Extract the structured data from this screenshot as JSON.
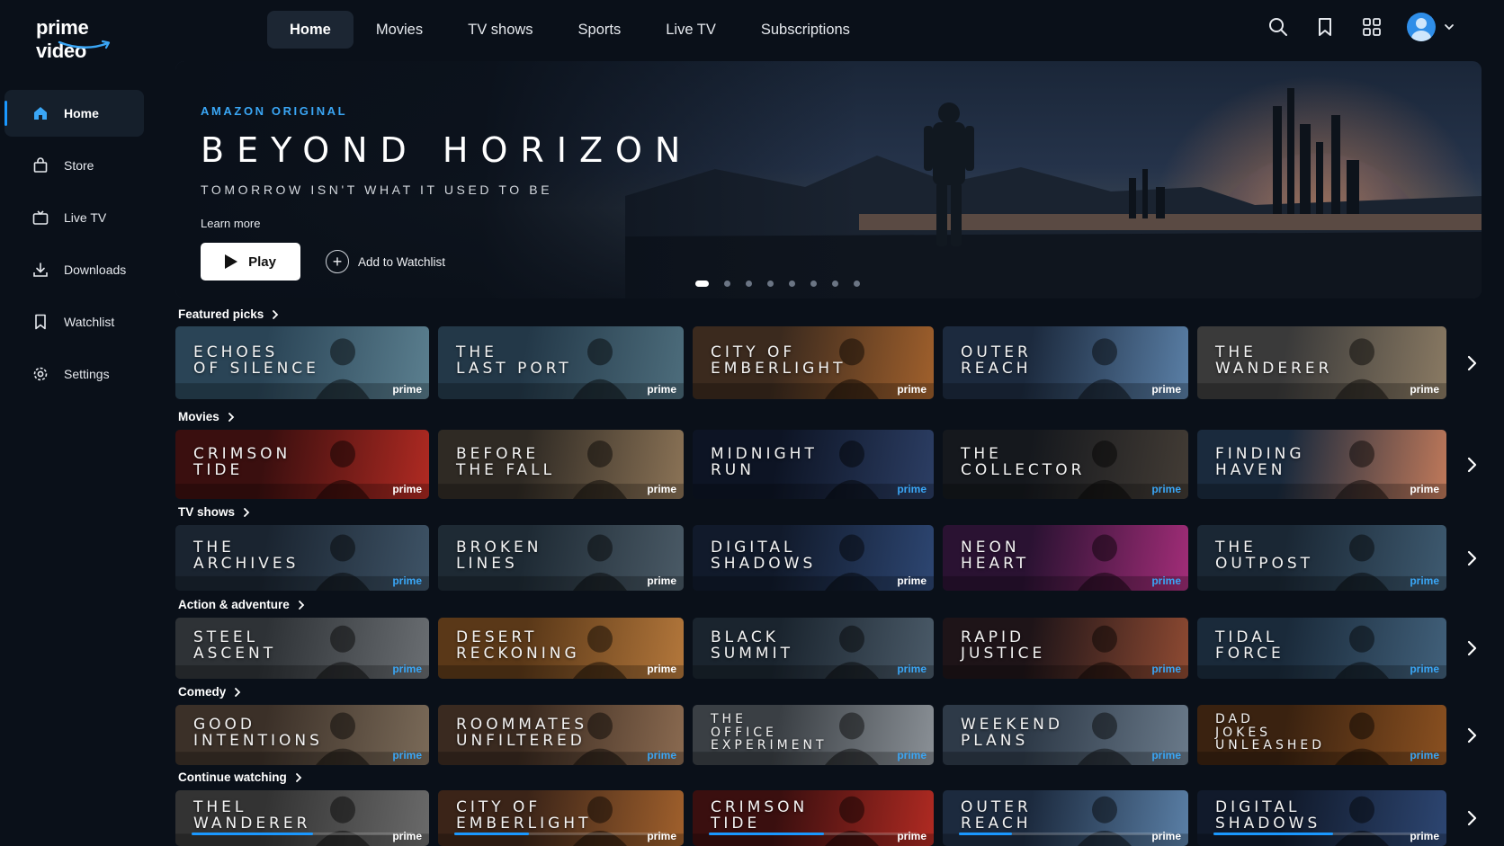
{
  "app": {
    "logo": "prime video"
  },
  "topnav": {
    "items": [
      {
        "label": "Home",
        "active": true
      },
      {
        "label": "Movies"
      },
      {
        "label": "TV shows"
      },
      {
        "label": "Sports"
      },
      {
        "label": "Live TV"
      },
      {
        "label": "Subscriptions"
      }
    ],
    "icons": [
      "search-icon",
      "bookmark-icon",
      "grid-icon",
      "avatar"
    ]
  },
  "sidebar": {
    "items": [
      {
        "label": "Home",
        "icon": "home-icon",
        "active": true
      },
      {
        "label": "Store",
        "icon": "bag-icon"
      },
      {
        "label": "Live TV",
        "icon": "tv-icon"
      },
      {
        "label": "Downloads",
        "icon": "download-icon"
      },
      {
        "label": "Watchlist",
        "icon": "bookmark-icon"
      },
      {
        "label": "Settings",
        "icon": "gear-icon"
      }
    ]
  },
  "hero": {
    "badge": "AMAZON ORIGINAL",
    "title": "BEYOND HORIZON",
    "tagline": "TOMORROW ISN'T WHAT IT USED TO BE",
    "learn_more": "Learn more",
    "play_label": "Play",
    "watchlist_label": "Add to Watchlist",
    "dots": 8,
    "active_dot": 0
  },
  "rows": [
    {
      "heading": "Featured picks",
      "cards": [
        {
          "title": "Echoes\nof silence",
          "badge": "prime",
          "badge_style": "white"
        },
        {
          "title": "The\nLast port",
          "badge": "prime",
          "badge_style": "white"
        },
        {
          "title": "City of\nEmberlight",
          "badge": "prime",
          "badge_style": "white"
        },
        {
          "title": "Outer\nReach",
          "badge": "prime",
          "badge_style": "white"
        },
        {
          "title": "The\nWanderer",
          "badge": "prime",
          "badge_style": "white"
        }
      ]
    },
    {
      "heading": "Movies",
      "cards": [
        {
          "title": "Crimson\nTide",
          "badge": "prime",
          "badge_style": "white"
        },
        {
          "title": "Before\nthe fall",
          "badge": "prime",
          "badge_style": "white"
        },
        {
          "title": "Midnight\nRun",
          "badge": "prime",
          "badge_style": "blue"
        },
        {
          "title": "The\nCollector",
          "badge": "prime",
          "badge_style": "blue"
        },
        {
          "title": "Finding\nHaven",
          "badge": "prime",
          "badge_style": "white"
        }
      ]
    },
    {
      "heading": "TV shows",
      "cards": [
        {
          "title": "The\nArchives",
          "badge": "prime",
          "badge_style": "blue"
        },
        {
          "title": "Broken\nLines",
          "badge": "prime",
          "badge_style": "white"
        },
        {
          "title": "Digital\nShadows",
          "badge": "prime",
          "badge_style": "white"
        },
        {
          "title": "Neon\nHeart",
          "badge": "prime",
          "badge_style": "blue"
        },
        {
          "title": "The\nOutpost",
          "badge": "prime",
          "badge_style": "blue"
        }
      ]
    },
    {
      "heading": "Action & adventure",
      "cards": [
        {
          "title": "Steel\nAscent",
          "badge": "prime",
          "badge_style": "blue"
        },
        {
          "title": "Desert\nReckoning",
          "badge": "prime",
          "badge_style": "white"
        },
        {
          "title": "Black\nSummit",
          "badge": "prime",
          "badge_style": "blue"
        },
        {
          "title": "Rapid\nJustice",
          "badge": "prime",
          "badge_style": "blue"
        },
        {
          "title": "Tidal\nForce",
          "badge": "prime",
          "badge_style": "blue"
        }
      ]
    },
    {
      "heading": "Comedy",
      "cards": [
        {
          "title": "Good\nIntentions",
          "badge": "prime",
          "badge_style": "blue"
        },
        {
          "title": "Roommates\nUnfiltered",
          "badge": "prime",
          "badge_style": "blue"
        },
        {
          "title": "The\nOffice\nExperiment",
          "badge": "prime",
          "badge_style": "blue"
        },
        {
          "title": "Weekend\nPlans",
          "badge": "prime",
          "badge_style": "blue"
        },
        {
          "title": "Dad\nJokes\nUnleashed",
          "badge": "prime",
          "badge_style": "blue"
        }
      ]
    },
    {
      "heading": "Continue watching",
      "cards": [
        {
          "title": "Thel\nWanderer",
          "badge": "prime",
          "badge_style": "white",
          "progress": 0.55
        },
        {
          "title": "City of\nEmberlight",
          "badge": "prime",
          "badge_style": "white",
          "progress": 0.35
        },
        {
          "title": "Crimson\nTide",
          "badge": "prime",
          "badge_style": "white",
          "progress": 0.55
        },
        {
          "title": "Outer\nReach",
          "badge": "prime",
          "badge_style": "white",
          "progress": 0.25
        },
        {
          "title": "Digital\nShadows",
          "badge": "prime",
          "badge_style": "white",
          "progress": 0.55
        }
      ]
    }
  ],
  "colors": {
    "accent": "#1a98ff",
    "background": "#0a1019"
  }
}
